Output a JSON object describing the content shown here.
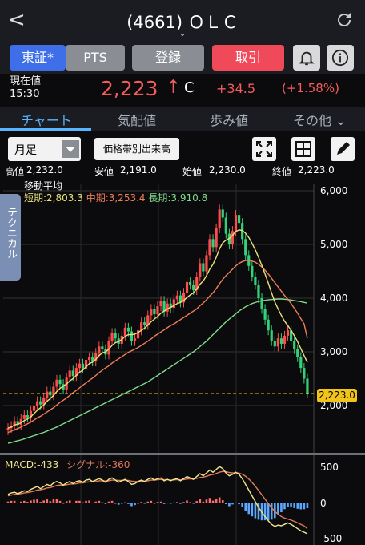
{
  "header": {
    "back_glyph": "<",
    "title": "(4661) ＯＬＣ",
    "chevron_glyph": "⌄"
  },
  "buttons": {
    "market": "東証*",
    "pts": "PTS",
    "register": "登録",
    "trade": "取引"
  },
  "price": {
    "label_line1": "現在値",
    "label_line2": "15:30",
    "value": "2,223",
    "arrow": "↑",
    "flag": "C",
    "change": "+34.5",
    "change_pct": "(+1.58%)"
  },
  "tabs": [
    "チャート",
    "気配値",
    "歩み値",
    "その他 ⌄"
  ],
  "toolbar": {
    "period": "月足",
    "volume_by_price": "価格帯別出来高"
  },
  "ohlc": {
    "high_label": "高値",
    "high": "2,232.0",
    "low_label": "安値",
    "low": "2,191.0",
    "open_label": "始値",
    "open": "2,230.0",
    "close_label": "終値",
    "close": "2,223.0"
  },
  "side_tab": "テクニカル",
  "ma": {
    "title": "移動平均",
    "short": "短期:2,803.3",
    "mid": "中期:3,253.4",
    "long": "長期:3,910.8"
  },
  "macd": {
    "label": "MACD:-433",
    "signal": "シグナル:-360"
  },
  "chart_data": {
    "type": "candlestick",
    "price_axis_ticks": [
      "6,000",
      "5,000",
      "4,000",
      "3,000",
      "2,000"
    ],
    "macd_axis_ticks": [
      "500",
      "0",
      "-500"
    ],
    "last_price_label": "2,223.0",
    "colors": {
      "up": "#ff4d4d",
      "down": "#34d07a",
      "short_ma": "#e8e27a",
      "mid_ma": "#f07d5a",
      "long_ma": "#7fdc8a",
      "macd": "#f0e68c",
      "signal": "#e07a5a",
      "hist_pos": "#ff6b6b",
      "hist_neg": "#5aa8ff"
    },
    "closes": [
      1580,
      1620,
      1710,
      1640,
      1750,
      1820,
      1780,
      1900,
      2000,
      2080,
      2020,
      2150,
      2260,
      2190,
      2350,
      2480,
      2400,
      2300,
      2520,
      2650,
      2550,
      2700,
      2780,
      2690,
      2850,
      2900,
      2820,
      2980,
      3100,
      3050,
      2950,
      3200,
      3350,
      3250,
      3150,
      3300,
      3450,
      3380,
      3200,
      3250,
      3400,
      3550,
      3500,
      3680,
      3800,
      3700,
      3850,
      3950,
      3750,
      3900,
      3820,
      3980,
      4050,
      3920,
      4100,
      4300,
      4250,
      4150,
      4400,
      4650,
      4500,
      4800,
      5100,
      4950,
      5300,
      5650,
      5500,
      5200,
      5000,
      5250,
      5550,
      5400,
      5100,
      4800,
      4600,
      4400,
      4250,
      4000,
      3800,
      3600,
      3400,
      3200,
      3100,
      3250,
      3150,
      3300,
      3400,
      3200,
      3050,
      2900,
      2700,
      2500,
      2223
    ],
    "ma_short": [
      1580,
      1600,
      1640,
      1650,
      1680,
      1720,
      1750,
      1790,
      1850,
      1910,
      1960,
      2010,
      2080,
      2130,
      2190,
      2260,
      2320,
      2360,
      2400,
      2460,
      2500,
      2560,
      2620,
      2660,
      2720,
      2780,
      2810,
      2860,
      2930,
      2980,
      3000,
      3050,
      3120,
      3170,
      3190,
      3230,
      3290,
      3320,
      3320,
      3330,
      3360,
      3400,
      3440,
      3500,
      3560,
      3610,
      3660,
      3720,
      3760,
      3800,
      3830,
      3860,
      3900,
      3920,
      3960,
      4010,
      4060,
      4100,
      4170,
      4260,
      4320,
      4420,
      4540,
      4630,
      4760,
      4920,
      5030,
      5080,
      5110,
      5170,
      5240,
      5270,
      5260,
      5210,
      5130,
      5020,
      4900,
      4760,
      4610,
      4450,
      4280,
      4100,
      3930,
      3800,
      3680,
      3570,
      3490,
      3400,
      3300,
      3190,
      3060,
      2930,
      2803
    ],
    "ma_mid": [
      1500,
      1520,
      1550,
      1570,
      1600,
      1630,
      1660,
      1690,
      1730,
      1770,
      1800,
      1840,
      1880,
      1920,
      1960,
      2010,
      2060,
      2100,
      2140,
      2190,
      2240,
      2280,
      2330,
      2380,
      2420,
      2470,
      2510,
      2560,
      2610,
      2660,
      2700,
      2740,
      2790,
      2830,
      2870,
      2910,
      2950,
      2990,
      3020,
      3050,
      3080,
      3120,
      3160,
      3200,
      3240,
      3290,
      3330,
      3370,
      3410,
      3450,
      3490,
      3520,
      3560,
      3600,
      3640,
      3680,
      3720,
      3760,
      3800,
      3860,
      3910,
      3970,
      4040,
      4100,
      4180,
      4270,
      4350,
      4420,
      4480,
      4540,
      4600,
      4650,
      4680,
      4700,
      4700,
      4690,
      4670,
      4630,
      4580,
      4520,
      4450,
      4370,
      4290,
      4210,
      4130,
      4050,
      3980,
      3900,
      3810,
      3720,
      3620,
      3520,
      3253
    ],
    "ma_long": [
      1300,
      1310,
      1330,
      1345,
      1360,
      1380,
      1400,
      1420,
      1440,
      1460,
      1480,
      1500,
      1525,
      1550,
      1575,
      1600,
      1630,
      1660,
      1690,
      1720,
      1750,
      1780,
      1810,
      1840,
      1870,
      1900,
      1930,
      1960,
      1990,
      2020,
      2050,
      2080,
      2110,
      2140,
      2170,
      2200,
      2230,
      2260,
      2290,
      2320,
      2350,
      2380,
      2410,
      2440,
      2480,
      2520,
      2560,
      2600,
      2640,
      2680,
      2720,
      2760,
      2800,
      2840,
      2880,
      2920,
      2960,
      3000,
      3050,
      3100,
      3150,
      3200,
      3260,
      3320,
      3380,
      3440,
      3500,
      3560,
      3610,
      3660,
      3710,
      3760,
      3800,
      3840,
      3870,
      3900,
      3920,
      3940,
      3950,
      3960,
      3970,
      3975,
      3980,
      3985,
      3985,
      3980,
      3975,
      3965,
      3955,
      3945,
      3935,
      3920,
      3910
    ],
    "macd_line": [
      120,
      140,
      150,
      130,
      150,
      170,
      160,
      190,
      210,
      230,
      200,
      230,
      260,
      240,
      280,
      300,
      280,
      250,
      280,
      300,
      270,
      300,
      310,
      290,
      320,
      330,
      300,
      320,
      340,
      320,
      290,
      330,
      350,
      320,
      290,
      310,
      330,
      300,
      260,
      270,
      300,
      320,
      300,
      330,
      350,
      320,
      340,
      350,
      310,
      330,
      310,
      330,
      340,
      310,
      340,
      370,
      350,
      330,
      370,
      410,
      380,
      420,
      460,
      430,
      470,
      510,
      480,
      420,
      380,
      400,
      430,
      400,
      340,
      260,
      180,
      100,
      20,
      -60,
      -130,
      -190,
      -250,
      -300,
      -330,
      -310,
      -320,
      -300,
      -280,
      -300,
      -330,
      -360,
      -390,
      -410,
      -433
    ],
    "signal_line": [
      100,
      110,
      120,
      125,
      130,
      140,
      145,
      155,
      165,
      180,
      185,
      195,
      210,
      215,
      230,
      245,
      250,
      250,
      255,
      265,
      265,
      270,
      280,
      280,
      290,
      295,
      295,
      300,
      310,
      310,
      305,
      310,
      320,
      320,
      315,
      315,
      320,
      315,
      305,
      300,
      300,
      305,
      305,
      310,
      320,
      320,
      325,
      330,
      325,
      325,
      320,
      323,
      327,
      323,
      327,
      335,
      338,
      336,
      343,
      356,
      361,
      373,
      390,
      398,
      412,
      431,
      441,
      437,
      426,
      421,
      423,
      418,
      402,
      374,
      335,
      288,
      234,
      175,
      114,
      53,
      -8,
      -66,
      -119,
      -157,
      -190,
      -212,
      -226,
      -240,
      -258,
      -278,
      -300,
      -322,
      -360
    ]
  }
}
